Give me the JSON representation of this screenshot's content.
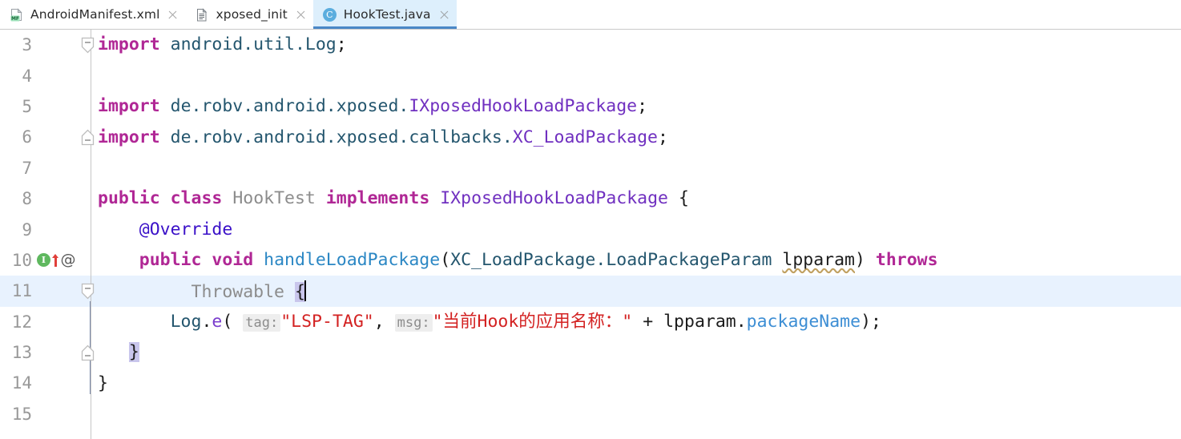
{
  "tabs": [
    {
      "label": "AndroidManifest.xml",
      "icon": "xml-manifest-icon",
      "active": false,
      "close_icon": "close-icon"
    },
    {
      "label": "xposed_init",
      "icon": "text-file-icon",
      "active": false,
      "close_icon": "close-icon"
    },
    {
      "label": "HookTest.java",
      "icon": "java-class-icon",
      "active": true,
      "close_icon": "close-icon"
    }
  ],
  "editor": {
    "language": "Java",
    "current_line": 11,
    "caret_line": 11,
    "gutter_marks": {
      "line10": {
        "implements_icon": "implementing-method-icon",
        "implements_letter": "I",
        "override_arrow_icon": "override-arrow-icon",
        "annotation_icon": "annotation-at-icon",
        "annotation_glyph": "@"
      }
    },
    "fold_markers": [
      {
        "line": 3,
        "type": "expanded-region-start"
      },
      {
        "line": 6,
        "type": "expanded-region-end"
      },
      {
        "line": 11,
        "type": "expanded-region-start"
      },
      {
        "line": 13,
        "type": "expanded-region-end"
      }
    ],
    "lines": [
      {
        "no": "3",
        "text": "import android.util.Log;"
      },
      {
        "no": "4",
        "text": ""
      },
      {
        "no": "5",
        "text": "import de.robv.android.xposed.IXposedHookLoadPackage;"
      },
      {
        "no": "6",
        "text": "import de.robv.android.xposed.callbacks.XC_LoadPackage;"
      },
      {
        "no": "7",
        "text": ""
      },
      {
        "no": "8",
        "text": "public class HookTest implements IXposedHookLoadPackage {"
      },
      {
        "no": "9",
        "text": "    @Override"
      },
      {
        "no": "10",
        "text": "    public void handleLoadPackage(XC_LoadPackage.LoadPackageParam lpparam) throws"
      },
      {
        "no": "11",
        "text": "            Throwable {"
      },
      {
        "no": "12",
        "text": "        Log.e( tag: \"LSP-TAG\", msg: \"当前Hook的应用名称：\" + lpparam.packageName);"
      },
      {
        "no": "13",
        "text": "    }"
      },
      {
        "no": "14",
        "text": "}"
      },
      {
        "no": "15",
        "text": ""
      }
    ],
    "tokens": {
      "kw_import": "import",
      "kw_public": "public",
      "kw_class": "class",
      "kw_implements": "implements",
      "kw_void": "void",
      "kw_throws": "throws",
      "pkg_android_util": "android.util.",
      "type_Log": "Log",
      "semi": ";",
      "pkg_de_robv": "de.robv.android.xposed.",
      "type_IXposedHookLoadPackage": "IXposedHookLoadPackage",
      "pkg_de_robv_callbacks": "de.robv.android.xposed.callbacks.",
      "type_XC_LoadPackage": "XC_LoadPackage",
      "class_HookTest": "HookTest",
      "brace_open": "{",
      "brace_close": "}",
      "annotation_override": "@Override",
      "method_handleLoadPackage": "handleLoadPackage",
      "paren_open": "(",
      "paren_close": ")",
      "param_type": "XC_LoadPackage.LoadPackageParam",
      "param_name": "lpparam",
      "type_Throwable": "Throwable",
      "log_obj": "Log",
      "dot": ".",
      "log_method": "e",
      "hint_tag": "tag:",
      "str_tag": "\"LSP-TAG\"",
      "comma": ",",
      "hint_msg": "msg:",
      "str_msg": "\"当前Hook的应用名称：\"",
      "plus": "+",
      "var_lpparam": "lpparam",
      "field_packageName": "packageName",
      "close_stmt": ");"
    },
    "colors": {
      "keyword": "#b02795",
      "class_name": "#7030c0",
      "identifier": "#24566e",
      "annotation": "#3a10c8",
      "method": "#2b87c4",
      "field": "#3d8ed4",
      "string": "#d32222",
      "gray_text": "#8c8c8c",
      "line_number": "#999999",
      "current_line_bg": "#e8f2fe",
      "active_tab_bg": "#ddeffc",
      "active_tab_underline": "#4a88c7",
      "brace_match_bg": "#c9c6ec",
      "param_hint_bg": "#eeeeee"
    }
  }
}
